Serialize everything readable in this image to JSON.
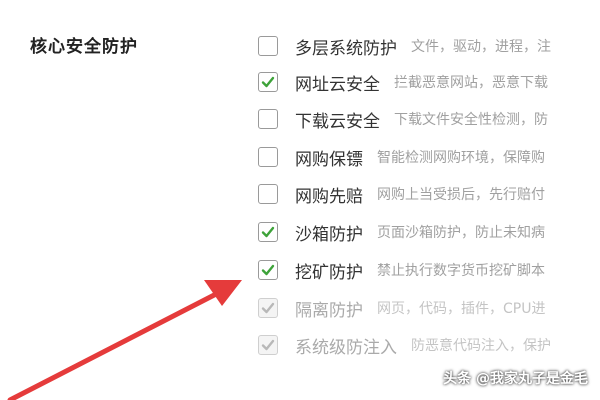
{
  "section": {
    "title": "核心安全防护"
  },
  "options": [
    {
      "label": "多层系统防护",
      "desc": "文件，驱动，进程，注",
      "checked": false,
      "disabled": false
    },
    {
      "label": "网址云安全",
      "desc": "拦截恶意网站，恶意下载",
      "checked": true,
      "disabled": false
    },
    {
      "label": "下载云安全",
      "desc": "下载文件安全性检测，防",
      "checked": false,
      "disabled": false
    },
    {
      "label": "网购保镖",
      "desc": "智能检测网购环境，保障购",
      "checked": false,
      "disabled": false
    },
    {
      "label": "网购先赔",
      "desc": "网购上当受损后，先行赔付",
      "checked": false,
      "disabled": false
    },
    {
      "label": "沙箱防护",
      "desc": "页面沙箱防护，防止未知病",
      "checked": true,
      "disabled": false
    },
    {
      "label": "挖矿防护",
      "desc": "禁止执行数字货币挖矿脚本",
      "checked": true,
      "disabled": false
    },
    {
      "label": "隔离防护",
      "desc": "网页，代码，插件，CPU进",
      "checked": true,
      "disabled": true
    },
    {
      "label": "系统级防注入",
      "desc": "防恶意代码注入，保护",
      "checked": true,
      "disabled": true
    }
  ],
  "colors": {
    "check": "#3ea33a",
    "arrow": "#e53b3b"
  },
  "watermark": "头条 @我家丸子是金毛"
}
